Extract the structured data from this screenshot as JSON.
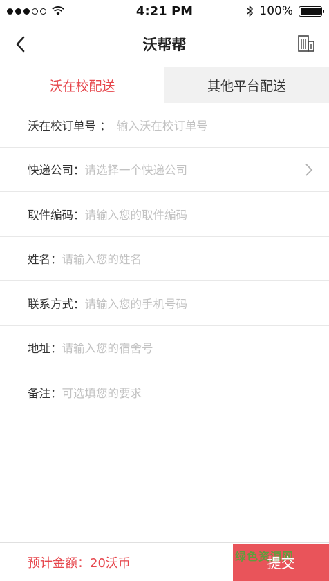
{
  "status_bar": {
    "time": "4:21 PM",
    "battery_text": "100%",
    "signal_icon": "signal-dots-icon",
    "wifi_icon": "wifi-icon",
    "bluetooth_icon": "bluetooth-icon",
    "battery_icon": "battery-icon"
  },
  "nav": {
    "title": "沃帮帮",
    "back_icon": "chevron-left-icon",
    "right_icon": "building-icon"
  },
  "tabs": [
    {
      "label": "沃在校配送",
      "active": true
    },
    {
      "label": "其他平台配送",
      "active": false
    }
  ],
  "form": {
    "rows": [
      {
        "label": "沃在校订单号 ：",
        "placeholder": "输入沃在校订单号"
      },
      {
        "label": "快递公司：",
        "placeholder": "请选择一个快递公司",
        "has_chevron": true
      },
      {
        "label": "取件编码：",
        "placeholder": "请输入您的取件编码"
      },
      {
        "label": "姓名：",
        "placeholder": "请输入您的姓名"
      },
      {
        "label": "联系方式：",
        "placeholder": "请输入您的手机号码"
      },
      {
        "label": "地址：",
        "placeholder": "请输入您的宿舍号"
      },
      {
        "label": "备注：",
        "placeholder": "可选填您的要求"
      }
    ]
  },
  "footer": {
    "total_text": "预计金额：20沃币",
    "submit_label": "提交",
    "watermark_text": "绿色资源网"
  },
  "colors": {
    "accent": "#e6464c",
    "submit_bg": "#e9545a",
    "placeholder": "#c2c2c2",
    "tab_inactive_bg": "#f1f1f1"
  }
}
